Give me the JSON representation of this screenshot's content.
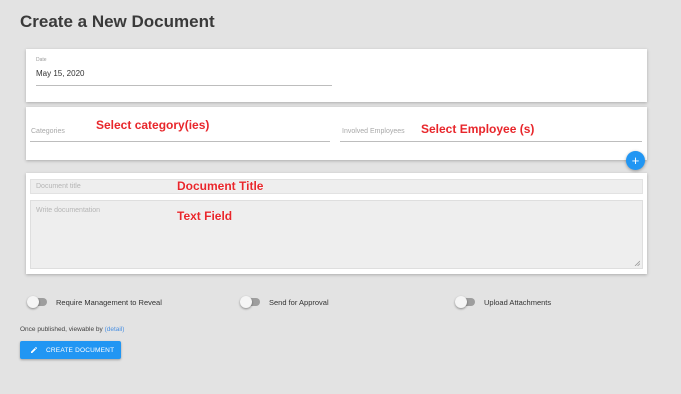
{
  "page": {
    "title": "Create a New Document"
  },
  "date_field": {
    "label": "Date",
    "value": "May 15, 2020"
  },
  "categories_field": {
    "placeholder": "Categories",
    "annotation": "Select category(ies)"
  },
  "employees_field": {
    "placeholder": "Involved Employees",
    "annotation": "Select Employee (s)"
  },
  "add_button": {
    "icon": "plus-icon",
    "glyph": "+"
  },
  "document": {
    "title_placeholder": "Document title",
    "title_annotation": "Document Title",
    "body_placeholder": "Write documentation",
    "body_annotation": "Text Field"
  },
  "toggles": [
    {
      "label": "Require Management to Reveal",
      "on": false
    },
    {
      "label": "Send for Approval",
      "on": false
    },
    {
      "label": "Upload Attachments",
      "on": false
    }
  ],
  "visibility": {
    "text": "Once published, viewable by",
    "link": "(detail)"
  },
  "create_button": {
    "label": "CREATE DOCUMENT",
    "icon": "pencil-icon"
  },
  "colors": {
    "accent": "#2196f3",
    "annotation": "#e8262b",
    "background": "#e3e3e3",
    "link": "#4a90e2"
  }
}
